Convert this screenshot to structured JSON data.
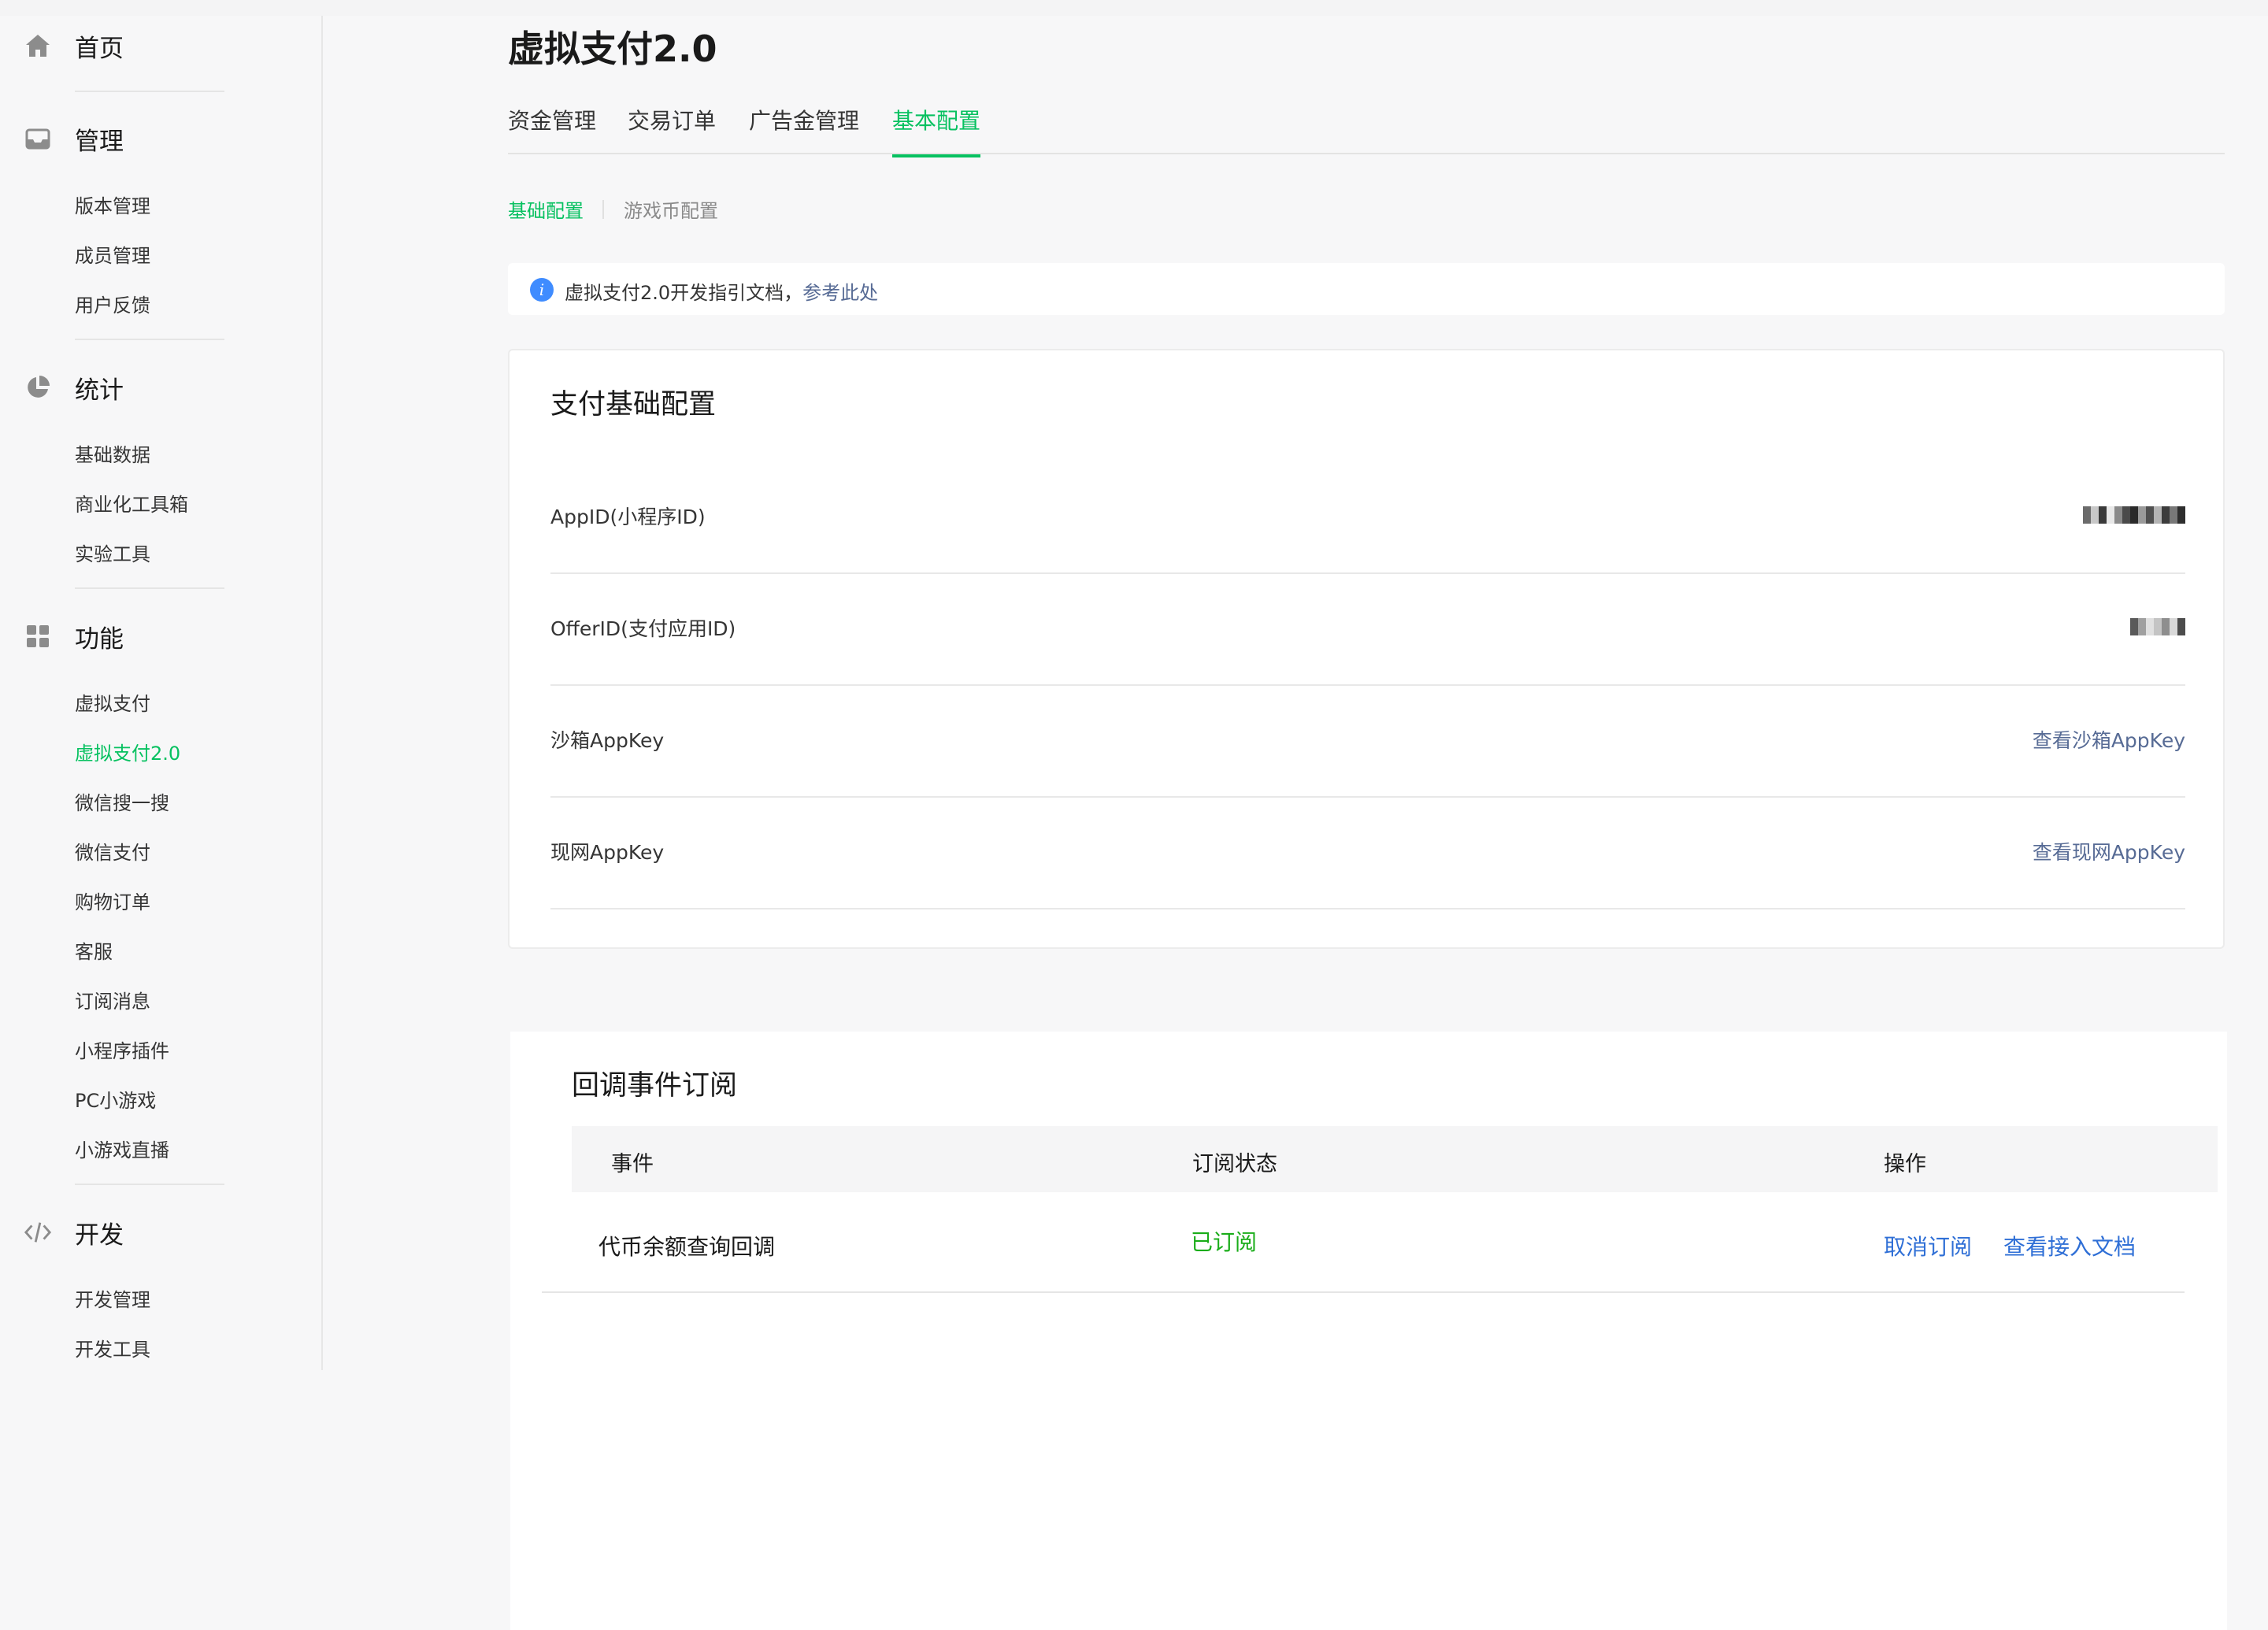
{
  "sidebar": {
    "sections": [
      {
        "title": "首页",
        "icon": "home-icon",
        "items": []
      },
      {
        "title": "管理",
        "icon": "inbox-icon",
        "items": [
          "版本管理",
          "成员管理",
          "用户反馈"
        ]
      },
      {
        "title": "统计",
        "icon": "pie-chart-icon",
        "items": [
          "基础数据",
          "商业化工具箱",
          "实验工具"
        ]
      },
      {
        "title": "功能",
        "icon": "grid-icon",
        "items": [
          "虚拟支付",
          "虚拟支付2.0",
          "微信搜一搜",
          "微信支付",
          "购物订单",
          "客服",
          "订阅消息",
          "小程序插件",
          "PC小游戏",
          "小游戏直播"
        ]
      },
      {
        "title": "开发",
        "icon": "code-icon",
        "items": [
          "开发管理",
          "开发工具"
        ]
      }
    ],
    "active_item": "虚拟支付2.0"
  },
  "page": {
    "title": "虚拟支付2.0",
    "tabs": [
      "资金管理",
      "交易订单",
      "广告金管理",
      "基本配置"
    ],
    "active_tab": "基本配置",
    "subtabs": [
      "基础配置",
      "游戏币配置"
    ],
    "active_subtab": "基础配置"
  },
  "notice": {
    "text": "虚拟支付2.0开发指引文档，",
    "link": "参考此处"
  },
  "pay_config": {
    "title": "支付基础配置",
    "rows": [
      {
        "key": "AppID(小程序ID)",
        "value_obscured": true
      },
      {
        "key": "OfferID(支付应用ID)",
        "value_obscured": true
      },
      {
        "key": "沙箱AppKey",
        "action": "查看沙箱AppKey"
      },
      {
        "key": "现网AppKey",
        "action": "查看现网AppKey"
      }
    ]
  },
  "callback": {
    "title": "回调事件订阅",
    "headers": [
      "事件",
      "订阅状态",
      "操作"
    ],
    "rows": [
      {
        "event": "代币余额查询回调",
        "status": "已订阅",
        "actions": [
          "取消订阅",
          "查看接入文档"
        ]
      }
    ]
  },
  "colors": {
    "accent_green": "#07c160",
    "link_blue": "#576b95",
    "action_blue": "#2f6fd6",
    "status_green": "#1aad19"
  }
}
